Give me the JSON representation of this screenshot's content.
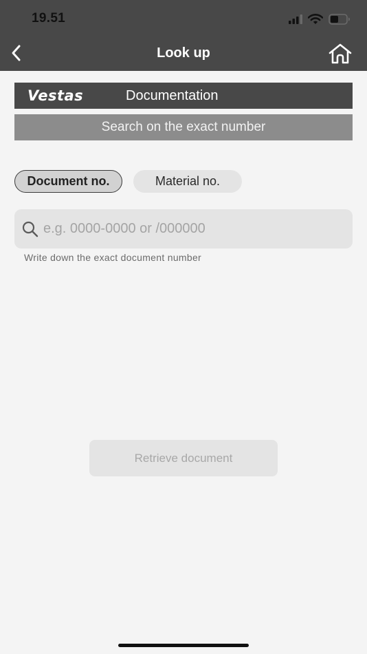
{
  "status_bar": {
    "time": "19.51",
    "icons": [
      "signal-icon",
      "wifi-icon",
      "battery-icon"
    ],
    "battery_level": 0.5
  },
  "nav": {
    "title": "Look up",
    "back_icon": "chevron-left-icon",
    "home_icon": "home-icon"
  },
  "brand": {
    "logo_text": "Vestas",
    "section": "Documentation"
  },
  "search_banner": "Search on the exact number",
  "tabs": [
    {
      "label": "Document no.",
      "selected": true
    },
    {
      "label": "Material no.",
      "selected": false
    }
  ],
  "search": {
    "placeholder": "e.g. 0000-0000 or /000000",
    "value": "",
    "helper": "Write down the exact document number"
  },
  "actions": {
    "retrieve_label": "Retrieve document",
    "retrieve_enabled": false
  },
  "colors": {
    "header_bg": "#484848",
    "banner_bg": "#8c8c8c",
    "page_bg": "#f4f4f4",
    "field_bg": "#e4e4e4"
  }
}
